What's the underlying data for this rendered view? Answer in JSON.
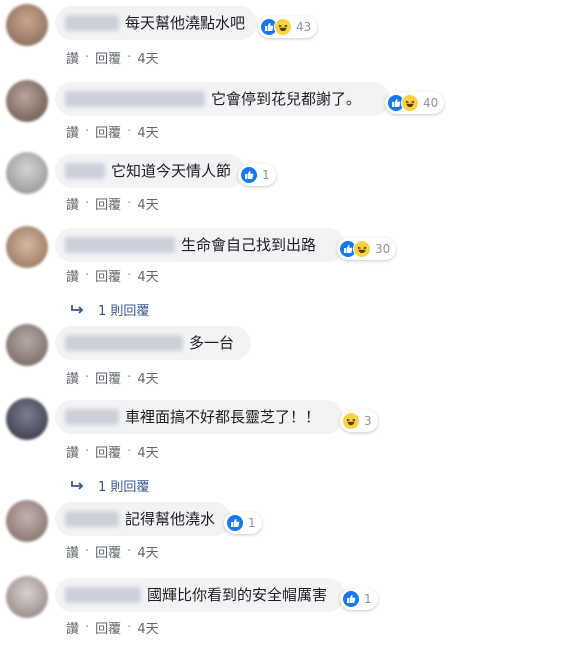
{
  "actions": {
    "like": "讚",
    "reply": "回覆",
    "sep": "·"
  },
  "comments": [
    {
      "text": "每天幫他澆點水吧",
      "reaction_count": "43",
      "age": "4天"
    },
    {
      "text": "它會停到花兒都謝了。",
      "reaction_count": "40",
      "age": "4天"
    },
    {
      "text": "它知道今天情人節",
      "reaction_count": "1",
      "age": "4天"
    },
    {
      "text": "生命會自己找到出路",
      "reaction_count": "30",
      "age": "4天",
      "replies": "1 則回覆"
    },
    {
      "text": "多一台",
      "age": "4天"
    },
    {
      "text": "車裡面搞不好都長靈芝了！！",
      "reaction_count": "3",
      "age": "4天",
      "replies": "1 則回覆"
    },
    {
      "text": "記得幫他澆水",
      "reaction_count": "1",
      "age": "4天"
    },
    {
      "text": "國輝比你看到的安全帽厲害",
      "reaction_count": "1",
      "age": "4天"
    }
  ],
  "colors": {
    "like_blue": "#1877f2",
    "haha_yellow": "#fcd240",
    "link_blue": "#385898",
    "bubble_bg": "#f2f3f5"
  }
}
